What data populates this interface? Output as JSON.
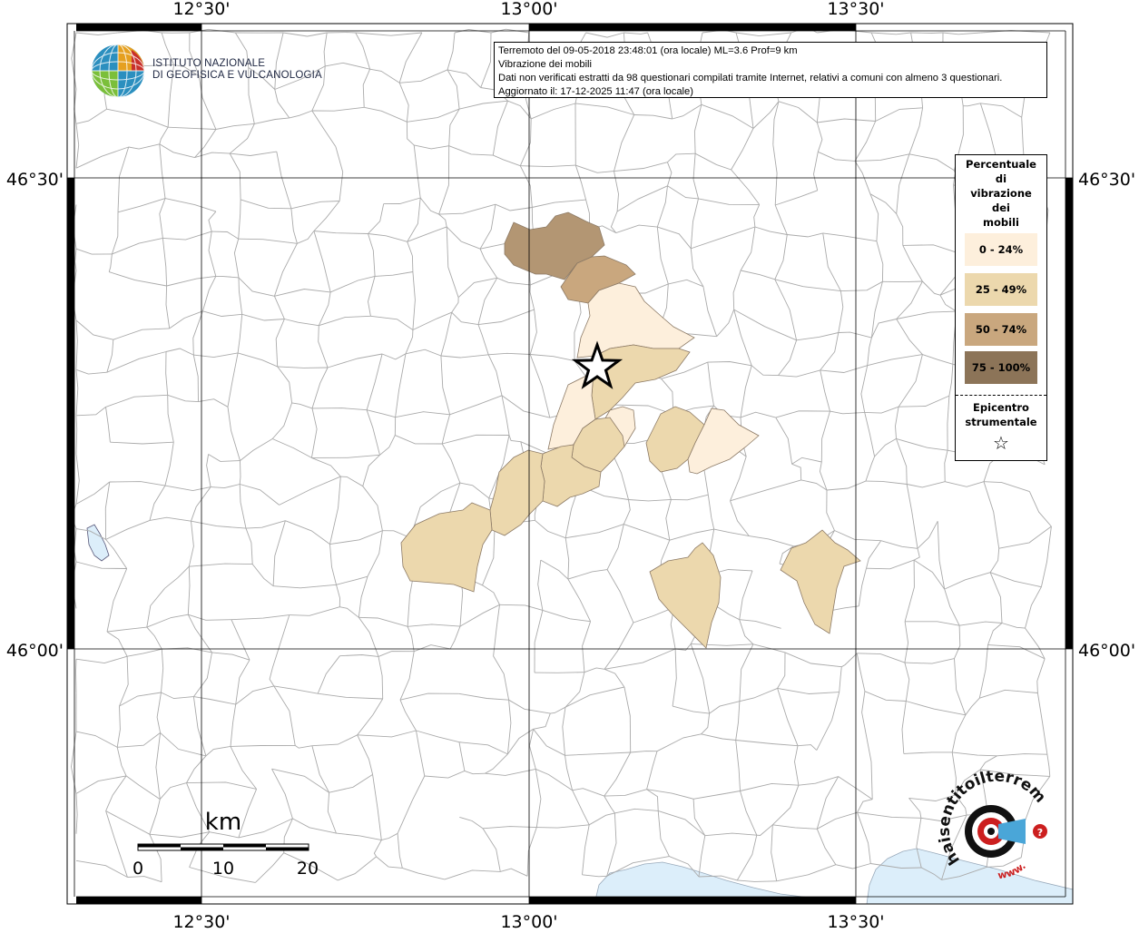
{
  "map": {
    "lon_ticks": [
      "12°30'",
      "13°00'",
      "13°30'"
    ],
    "lat_ticks": [
      "46°30'",
      "46°00'"
    ]
  },
  "info": {
    "line1": "Terremoto del 09-05-2018 23:48:01 (ora locale) ML=3.6 Prof=9 km",
    "line2": "Vibrazione dei mobili",
    "line3": "Dati non verificati estratti da 98 questionari compilati tramite Internet, relativi a comuni con almeno 3 questionari.",
    "line4": "Aggiornato il: 17-12-2025 11:47 (ora locale)"
  },
  "logo": {
    "line1": "ISTITUTO NAZIONALE",
    "line2": "DI GEOFISICA E VULCANOLOGIA"
  },
  "legend": {
    "title_lines": [
      "Percentuale",
      "di",
      "vibrazione",
      "dei",
      "mobili"
    ],
    "items": [
      {
        "label": "0 - 24%",
        "color": "#fdefdc"
      },
      {
        "label": "25 - 49%",
        "color": "#ecd8ad"
      },
      {
        "label": "50 - 74%",
        "color": "#c9a77e"
      },
      {
        "label": "75 - 100%",
        "color": "#8c7458"
      }
    ],
    "epicenter_line1": "Epicentro",
    "epicenter_line2": "strumentale",
    "epicenter_symbol": "☆"
  },
  "scalebar": {
    "unit": "km",
    "ticks": [
      "0",
      "10",
      "20"
    ]
  },
  "brand": {
    "text": "haisentitoilterremoto.it",
    "prefix": "www."
  },
  "colors": {
    "sea": "#dceefa",
    "border": "#aaaaaa",
    "frame": "#000000"
  }
}
